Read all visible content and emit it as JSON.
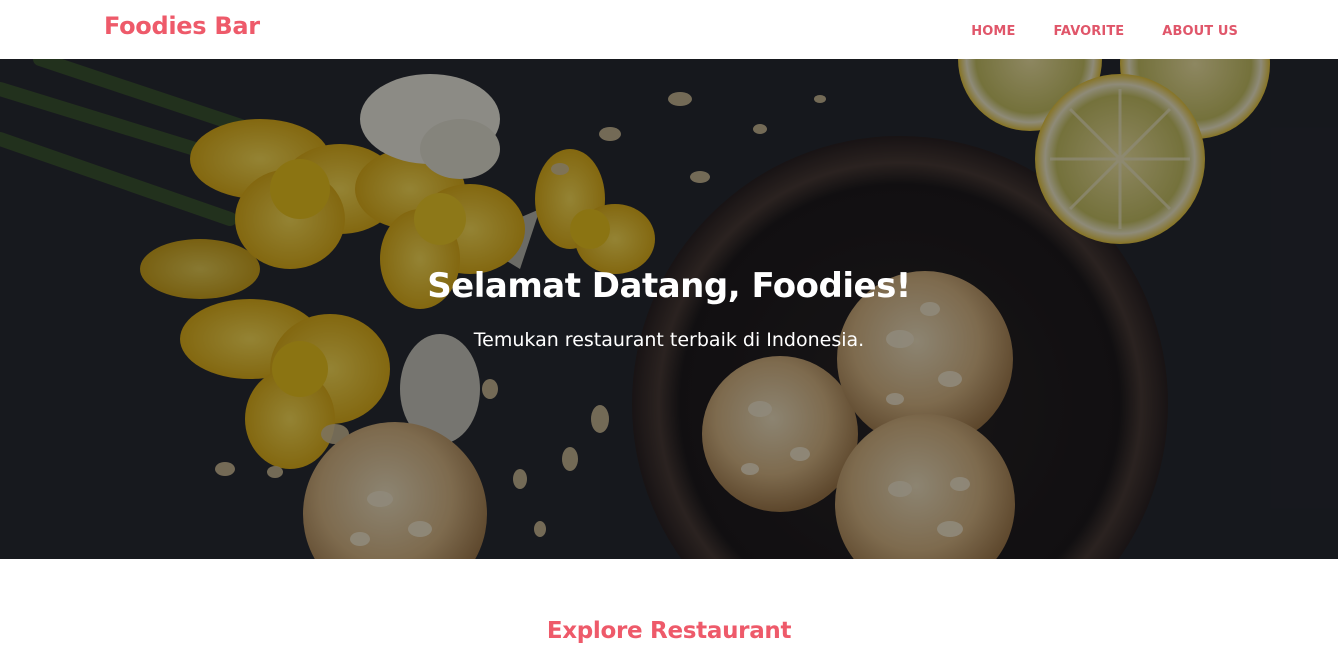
{
  "header": {
    "brand": "Foodies Bar",
    "nav": [
      {
        "label": "HOME"
      },
      {
        "label": "FAVORITE"
      },
      {
        "label": "ABOUT US"
      }
    ]
  },
  "hero": {
    "title": "Selamat Datang, Foodies!",
    "subtitle": "Temukan restaurant terbaik di Indonesia."
  },
  "explore": {
    "title": "Explore Restaurant"
  },
  "colors": {
    "accent": "#ee5a6a",
    "hero_bg": "#23232a",
    "text_light": "#ffffff"
  }
}
